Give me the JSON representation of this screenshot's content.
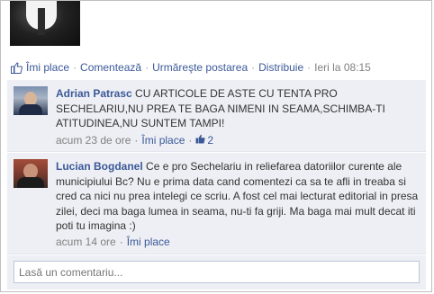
{
  "post": {
    "actions": {
      "like": "Îmi place",
      "comment": "Comentează",
      "follow": "Urmăreşte postarea",
      "share": "Distribuie",
      "time": "Ieri la 08:15",
      "separator": "·"
    }
  },
  "comments": [
    {
      "author": "Adrian Patrasc",
      "text": "CU ARTICOLE DE ASTE CU TENTA PRO SECHELARIU,NU PREA TE BAGA NIMENI IN SEAMA,SCHIMBA-TI ATITUDINEA,NU SUNTEM TAMPI!",
      "time": "acum 23 de ore",
      "like": "Îmi place",
      "likes_count": "2"
    },
    {
      "author": "Lucian Bogdanel",
      "text": "Ce e pro Sechelariu in reliefarea datoriilor curente ale municipiului Bc? Nu e prima data cand comentezi ca sa te afli in treaba si cred ca nici nu prea intelegi ce scriu. A fost cel mai lecturat editorial in presa zilei, deci ma baga lumea in seama, nu-ti fa griji. Ma baga mai mult decat iti poti tu imagina :)",
      "time": "acum 14 ore",
      "like": "Îmi place"
    }
  ],
  "comment_box": {
    "placeholder": "Lasă un comentariu..."
  },
  "colors": {
    "link": "#3b5998",
    "comment_bg": "#edeff4",
    "muted": "#808080"
  },
  "icons": {
    "post_like": "like-thumb-icon",
    "comment_like": "thumbs-up-icon"
  }
}
